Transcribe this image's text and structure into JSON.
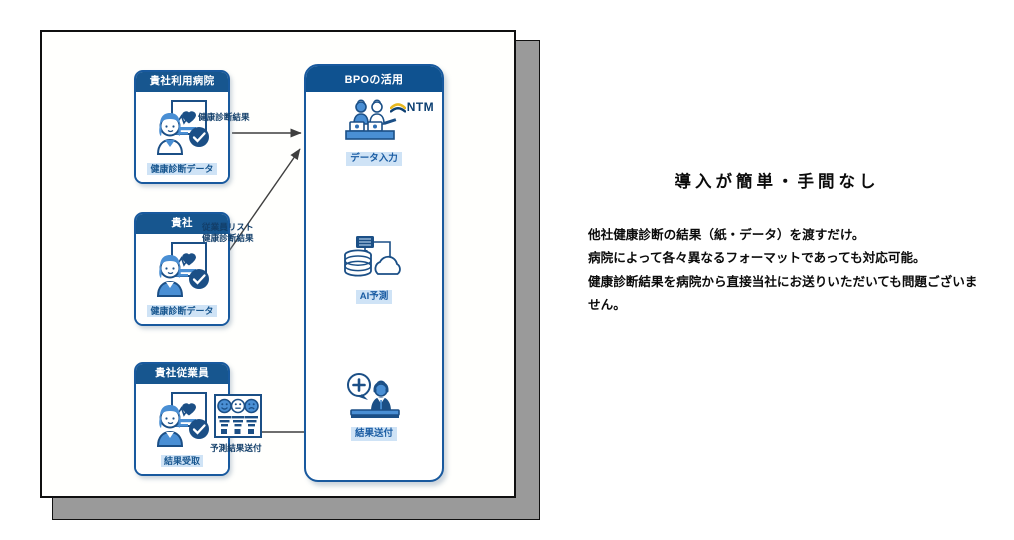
{
  "slide": {
    "diagram": {
      "left_cards": [
        {
          "id": "hospital",
          "header": "貴社利用病院",
          "caption": "健康診断データ",
          "icon": "doctor-health-record-icon"
        },
        {
          "id": "company",
          "header": "貴社",
          "caption": "健康診断データ",
          "icon": "employee-health-record-icon"
        },
        {
          "id": "employee",
          "header": "貴社従業員",
          "caption": "結果受取",
          "icon": "employee-receives-result-icon"
        }
      ],
      "bpo_panel": {
        "header": "BPOの活用",
        "logo_text": "NTM",
        "logo_mark": "ntm-swoosh-icon",
        "steps": [
          {
            "id": "input",
            "caption": "データ入力",
            "icon": "data-entry-operators-icon"
          },
          {
            "id": "ai",
            "caption": "AI予測",
            "icon": "database-cloud-ai-icon"
          },
          {
            "id": "send",
            "caption": "結果送付",
            "icon": "support-agent-result-icon"
          }
        ]
      },
      "connectors": [
        {
          "id": "kenko",
          "label": "健康診断結果"
        },
        {
          "id": "list",
          "label": "従業員リスト\n健康診断結果"
        },
        {
          "id": "yosoku",
          "label": "予測結果送付"
        }
      ],
      "connector_labels": {
        "kenko": "健康診断結果",
        "list_line1": "従業員リスト",
        "list_line2": "健康診断結果",
        "yosoku": "予測結果送付"
      },
      "smiley_chart_icon": "survey-faces-chart-icon"
    }
  },
  "right": {
    "title": "導入が簡単・手間なし",
    "paragraphs": [
      "他社健康診断の結果（紙・データ）を渡すだけ。",
      "病院によって各々異なるフォーマットであっても対応可能。",
      "健康診断結果を病院から直接当社にお送りいただいても問題ございません。"
    ]
  },
  "colors": {
    "navy_header": "#17568f",
    "bpo_header": "#0f5290",
    "card_border": "#18599e",
    "caption_bg": "#cfe3f6",
    "caption_text": "#1b5da3",
    "icon_light": "#4a8fd4",
    "icon_dark": "#1b4f86",
    "logo_gold": "#e8b820",
    "logo_navy": "#0c3f72",
    "page_shadow": "#9a9a9a",
    "text_black": "#0b0b0b"
  }
}
